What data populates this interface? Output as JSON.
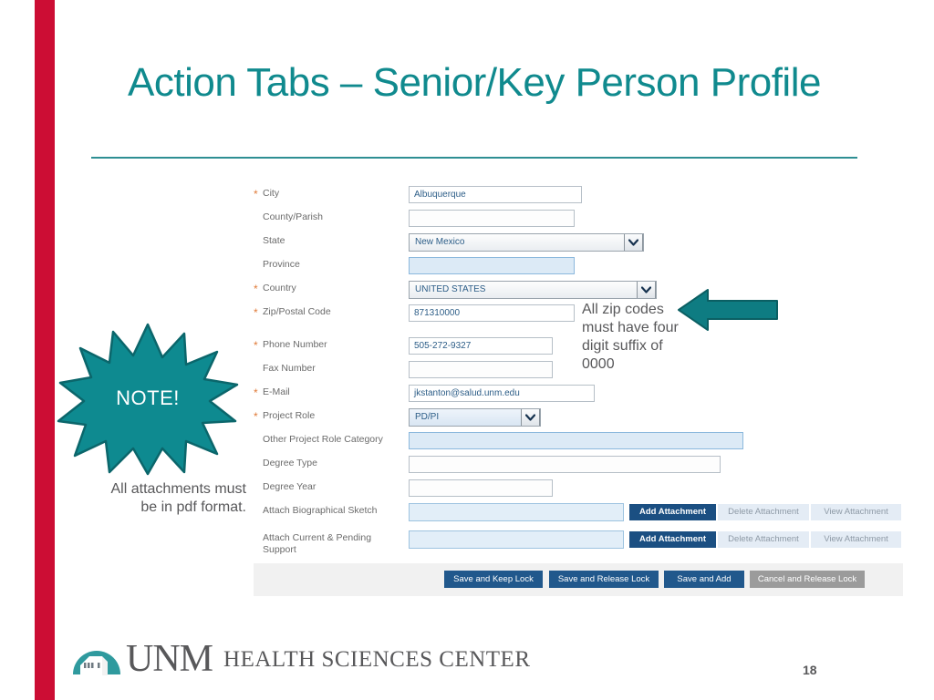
{
  "slide": {
    "title": "Action Tabs – Senior/Key Person Profile",
    "number": "18",
    "accent_teal": "#108a8e",
    "accent_red": "#cc0d34"
  },
  "form": {
    "fields": [
      {
        "label": "City",
        "required": true,
        "type": "text",
        "value": "Albuquerque",
        "state": "filled"
      },
      {
        "label": "County/Parish",
        "required": false,
        "type": "text",
        "value": "",
        "state": "empty"
      },
      {
        "label": "State",
        "required": false,
        "type": "select",
        "value": "New Mexico",
        "state": "normal"
      },
      {
        "label": "Province",
        "required": false,
        "type": "text",
        "value": "",
        "state": "readonly"
      },
      {
        "label": "Country",
        "required": true,
        "type": "select",
        "value": "UNITED STATES",
        "state": "normal"
      },
      {
        "label": "Zip/Postal Code",
        "required": true,
        "type": "text",
        "value": "871310000",
        "state": "filled"
      },
      {
        "label": "Phone Number",
        "required": true,
        "type": "text",
        "value": "505-272-9327",
        "state": "filled"
      },
      {
        "label": "Fax Number",
        "required": false,
        "type": "text",
        "value": "",
        "state": "empty"
      },
      {
        "label": "E-Mail",
        "required": true,
        "type": "text",
        "value": "jkstanton@salud.unm.edu",
        "state": "filled"
      },
      {
        "label": "Project Role",
        "required": true,
        "type": "select",
        "value": "PD/PI",
        "state": "blue"
      },
      {
        "label": "Other Project Role Category",
        "required": false,
        "type": "text",
        "value": "",
        "state": "readonly"
      },
      {
        "label": "Degree Type",
        "required": false,
        "type": "text",
        "value": "",
        "state": "empty"
      },
      {
        "label": "Degree Year",
        "required": false,
        "type": "text",
        "value": "",
        "state": "empty"
      },
      {
        "label": "Attach Biographical Sketch",
        "required": false,
        "type": "attachment",
        "value": "",
        "state": "attach"
      },
      {
        "label": "Attach Current & Pending\nSupport",
        "required": false,
        "type": "attachment",
        "value": "",
        "state": "attach"
      }
    ],
    "attachment_buttons": {
      "add": "Add Attachment",
      "delete": "Delete Attachment",
      "view": "View Attachment"
    },
    "action_buttons": [
      {
        "label": "Save and Keep Lock",
        "style": "blue"
      },
      {
        "label": "Save and Release Lock",
        "style": "blue"
      },
      {
        "label": "Save and Add",
        "style": "blue"
      },
      {
        "label": "Cancel and Release Lock",
        "style": "gray"
      }
    ]
  },
  "annotations": {
    "zip_callout": "All zip codes must have four digit suffix of 0000",
    "note_badge": "NOTE!",
    "note_caption": "All attachments must be in pdf format."
  },
  "logo": {
    "unm": "UNM",
    "tagline": "HEALTH SCIENCES CENTER"
  }
}
